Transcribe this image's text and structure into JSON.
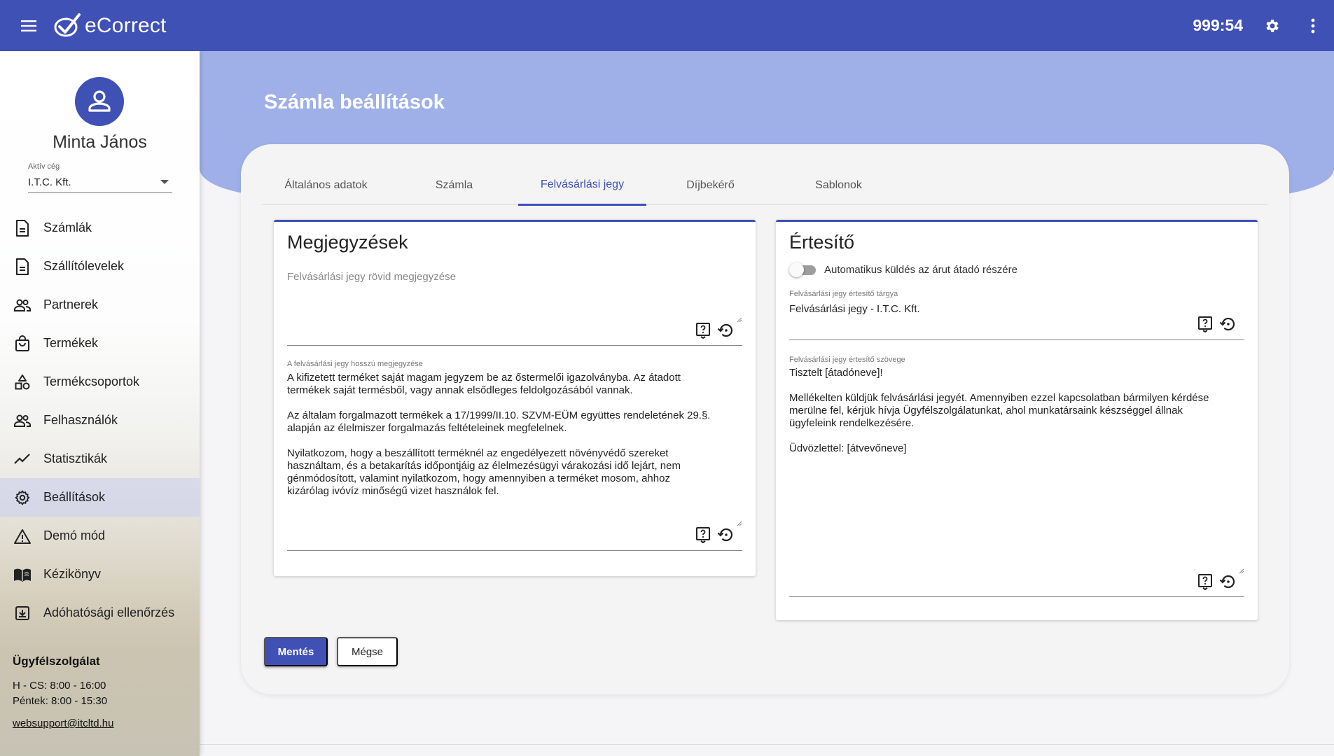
{
  "app": {
    "name": "eCorrect",
    "timer": "999:54"
  },
  "user": {
    "name": "Minta János",
    "company_label": "Aktív cég",
    "company": "I.T.C. Kft."
  },
  "sidebar": {
    "items": [
      {
        "label": "Számlák",
        "icon": "document-icon"
      },
      {
        "label": "Szállítólevelek",
        "icon": "document-icon"
      },
      {
        "label": "Partnerek",
        "icon": "people-icon"
      },
      {
        "label": "Termékek",
        "icon": "bag-icon"
      },
      {
        "label": "Termékcsoportok",
        "icon": "category-icon"
      },
      {
        "label": "Felhasználók",
        "icon": "people-icon"
      },
      {
        "label": "Statisztikák",
        "icon": "trending-icon"
      },
      {
        "label": "Beállítások",
        "icon": "gear-icon"
      },
      {
        "label": "Demó mód",
        "icon": "warning-icon"
      },
      {
        "label": "Kézikönyv",
        "icon": "book-icon"
      },
      {
        "label": "Adóhatósági ellenőrzés",
        "icon": "download-box-icon"
      }
    ],
    "active_index": 7
  },
  "support": {
    "title": "Ügyfélszolgálat",
    "hours_1": "H - CS: 8:00 - 16:00",
    "hours_2": "Péntek: 8:00 - 15:30",
    "email": "websupport@itcltd.hu"
  },
  "page": {
    "title": "Számla beállítások",
    "tabs": [
      "Általános adatok",
      "Számla",
      "Felvásárlási jegy",
      "Díjbekérő",
      "Sablonok"
    ],
    "active_tab": 2
  },
  "notes_panel": {
    "title": "Megjegyzések",
    "short_placeholder": "Felvásárlási jegy rövid megjegyzése",
    "long_label": "A felvásárlási jegy hosszú megjegyzése",
    "long_value": "A kifizetett terméket saját magam jegyzem be az őstermelői igazolványba. Az átadott\ntermékek saját termésből, vagy annak elsődleges feldolgozásából vannak.\n\nAz általam forgalmazott termékek a 17/1999/II.10. SZVM-EÜM együttes rendeletének 29.§.\nalapján az élelmiszer forgalmazás feltételeinek megfelelnek.\n\nNyilatkozom, hogy a beszállított terméknél az engedélyezett növényvédő szereket\nhasználtam, és a betakarítás időpontjáig az élelmezésügyi várakozási idő lejárt, nem\ngénmódosított, valamint nyilatkozom, hogy amennyiben a terméket mosom, ahhoz\nkizárólag ivóvíz minőségű vizet használok fel."
  },
  "notify_panel": {
    "title": "Értesítő",
    "toggle_label": "Automatikus küldés az árut átadó részére",
    "toggle_on": false,
    "subject_label": "Felvásárlási jegy értesítő tárgya",
    "subject_value": "Felvásárlási jegy - I.T.C. Kft.",
    "body_label": "Felvásárlási jegy értesítő szövege",
    "body_value": "Tisztelt [átadóneve]!\n\nMellékelten küldjük felvásárlási jegyét. Amennyiben ezzel kapcsolatban bármilyen kérdése\nmerülne fel, kérjük hívja Ügyfélszolgálatunkat, ahol munkatársaink készséggel állnak\nügyfeleink rendelkezésére.\n\nÜdvözlettel: [átvevőneve]"
  },
  "actions": {
    "save": "Mentés",
    "cancel": "Mégse"
  },
  "colors": {
    "primary": "#3f51b5",
    "header_band": "#9fb0e8"
  }
}
